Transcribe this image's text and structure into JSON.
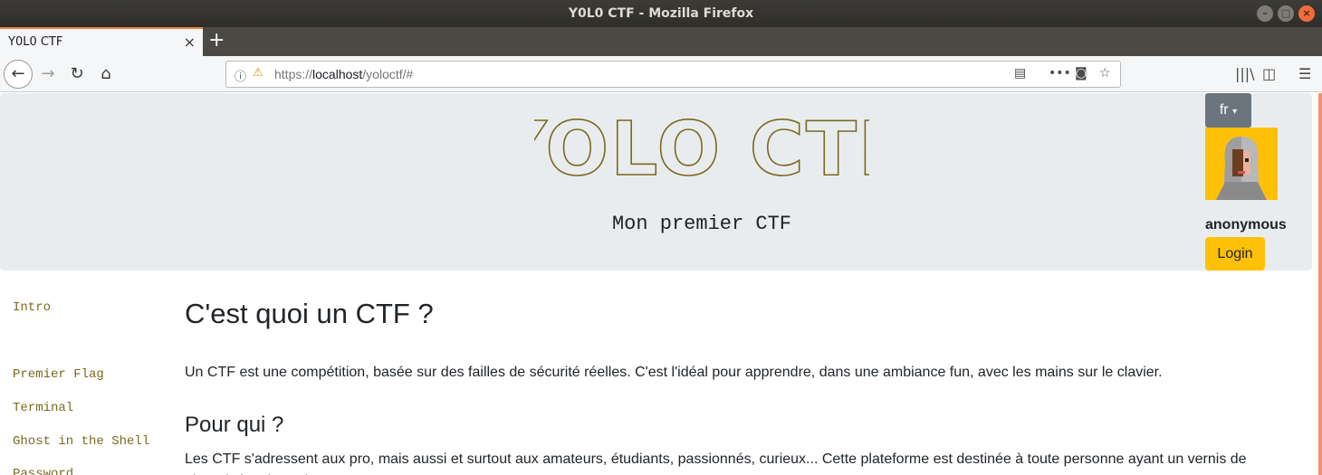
{
  "window": {
    "title": "Y0L0 CTF - Mozilla Firefox"
  },
  "browser": {
    "tab_title": "Y0L0 CTF",
    "tab_close": "×",
    "new_tab": "+",
    "url_prefix": "https://",
    "url_host": "localhost",
    "url_path": "/yoloctf/#"
  },
  "header": {
    "logo_text": "YOLO CTF",
    "tagline": "Mon premier CTF",
    "lang_label": "fr",
    "username": "anonymous",
    "login_label": "Login"
  },
  "sidebar": {
    "items": [
      {
        "label": "Intro"
      },
      {
        "label": "Premier Flag"
      },
      {
        "label": "Terminal"
      },
      {
        "label": "Ghost in the Shell"
      },
      {
        "label": "Password"
      }
    ]
  },
  "content": {
    "heading": "C'est quoi un CTF ?",
    "intro": "Un CTF est une compétition, basée sur des failles de sécurité réelles. C'est l'idéal pour apprendre, dans une ambiance fun, avec les mains sur le clavier.",
    "subheading": "Pour qui ?",
    "audience": "Les CTF s'adressent aux pro, mais aussi et surtout aux amateurs, étudiants, passionnés, curieux... Cette plateforme est destinée à toute personne ayant un vernis de Linux (a.k.a. ls, cat)."
  },
  "colors": {
    "accent": "#ffc107",
    "link": "#7a6a1e",
    "jumbotron": "#e9ecef",
    "secondary_button": "#6c757d"
  },
  "icons": [
    "back-icon",
    "forward-icon",
    "reload-icon",
    "home-icon",
    "info-icon",
    "insecure-lock-icon",
    "reader-view-icon",
    "more-icon",
    "pocket-icon",
    "bookmark-star-icon",
    "library-icon",
    "sidebar-icon",
    "menu-icon"
  ]
}
